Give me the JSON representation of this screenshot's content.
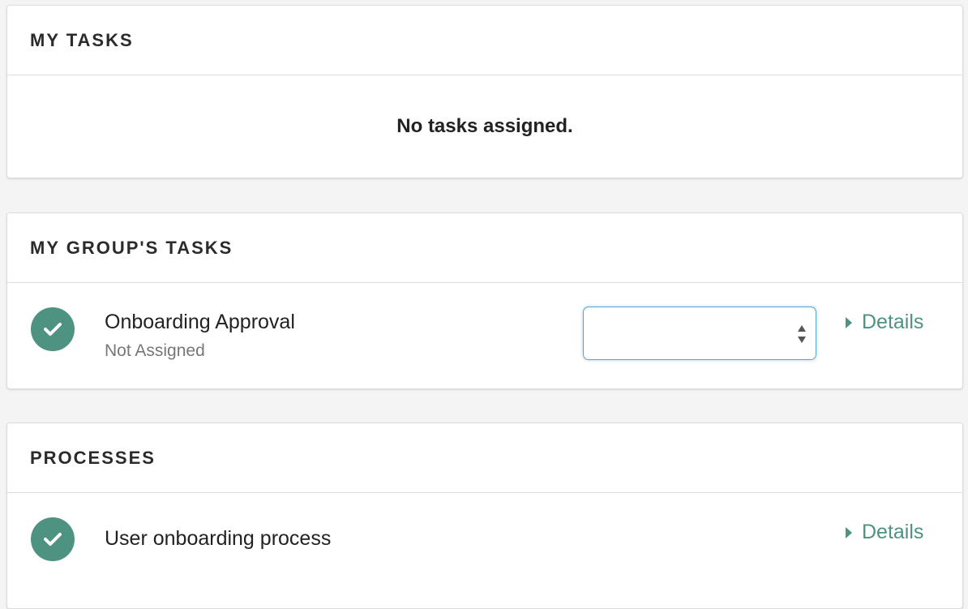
{
  "my_tasks": {
    "title": "MY TASKS",
    "empty_message": "No tasks assigned."
  },
  "group_tasks": {
    "title": "MY GROUP'S TASKS",
    "items": [
      {
        "icon": "check-circle-icon",
        "name": "Onboarding Approval",
        "status": "Not Assigned",
        "assignee_value": "",
        "details_label": "Details"
      }
    ]
  },
  "processes": {
    "title": "PROCESSES",
    "items": [
      {
        "icon": "check-circle-icon",
        "name": "User onboarding process",
        "details_label": "Details"
      }
    ]
  },
  "colors": {
    "accent": "#4e9282",
    "focus_border": "#5aa3d6",
    "background": "#f4f4f4"
  }
}
